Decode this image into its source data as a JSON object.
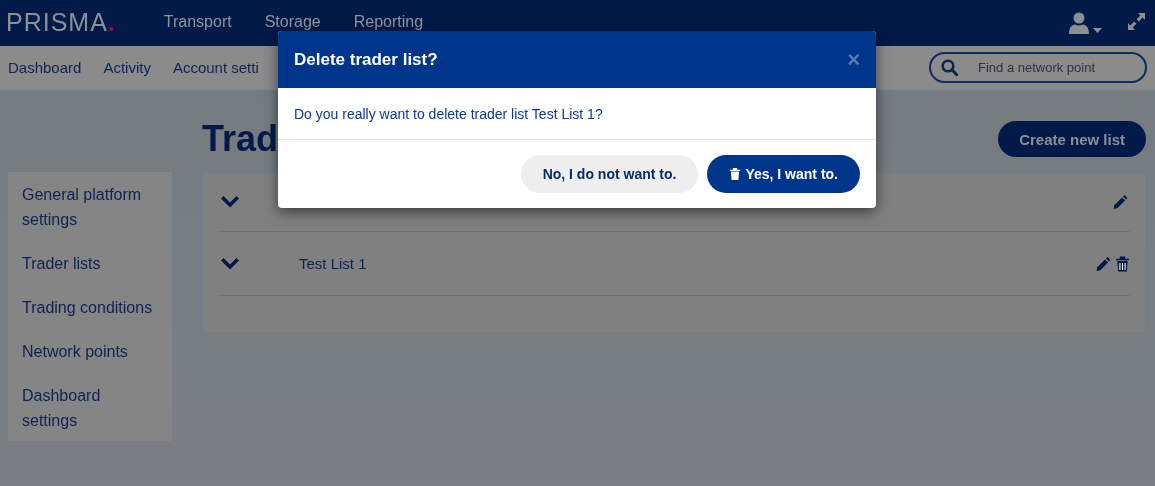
{
  "header": {
    "logo": {
      "text": "PRISMA",
      "mark": "."
    },
    "nav": [
      "Transport",
      "Storage",
      "Reporting"
    ]
  },
  "subnav": {
    "items": [
      "Dashboard",
      "Activity",
      "Account setti"
    ],
    "search": {
      "placeholder": "Find a network point"
    }
  },
  "page": {
    "title": "Trad",
    "create_button": "Create new list"
  },
  "sidebar": {
    "items": [
      "General platform settings",
      "Trader lists",
      "Trading conditions",
      "Network points",
      "Dashboard settings"
    ]
  },
  "lists": [
    {
      "editable": true,
      "deletable": false
    },
    {
      "name": "Test List 1",
      "editable": true,
      "deletable": true
    }
  ],
  "dialog": {
    "title": "Delete trader list?",
    "close": "×",
    "message": "Do you really want to delete trader list Test List 1?",
    "buttons": [
      {
        "label": "No, I do not want to.",
        "kind": "secondary"
      },
      {
        "label": "Yes, I want to.",
        "kind": "primary"
      }
    ]
  }
}
